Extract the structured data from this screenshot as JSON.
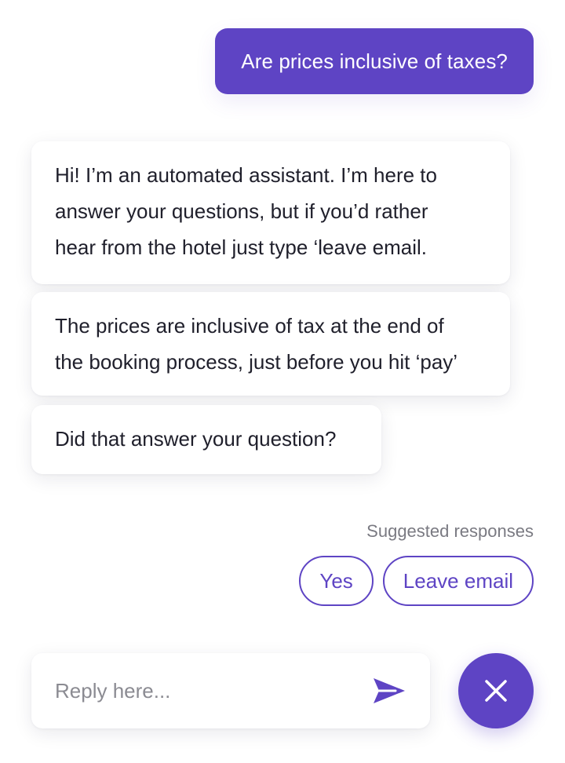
{
  "colors": {
    "accent": "#5e44c4",
    "text": "#1f1f2b",
    "muted": "#7a7a82",
    "background": "#ffffff"
  },
  "user_message": "Are prices inclusive of taxes?",
  "bot_messages": [
    {
      "lines": [
        "Hi! I’m an automated assistant. I’m here to",
        "answer your questions, but if you’d rather",
        "hear from the hotel just type ‘leave email."
      ]
    },
    {
      "lines": [
        "The prices are inclusive of tax at the end of",
        "the booking process, just before you hit ‘pay’"
      ]
    },
    {
      "lines": [
        "Did that answer your question?"
      ]
    }
  ],
  "suggested": {
    "label": "Suggested responses",
    "options": [
      "Yes",
      "Leave email"
    ]
  },
  "composer": {
    "placeholder": "Reply here...",
    "value": "",
    "send_icon": "send-icon"
  },
  "close_button": {
    "icon": "close-icon"
  }
}
